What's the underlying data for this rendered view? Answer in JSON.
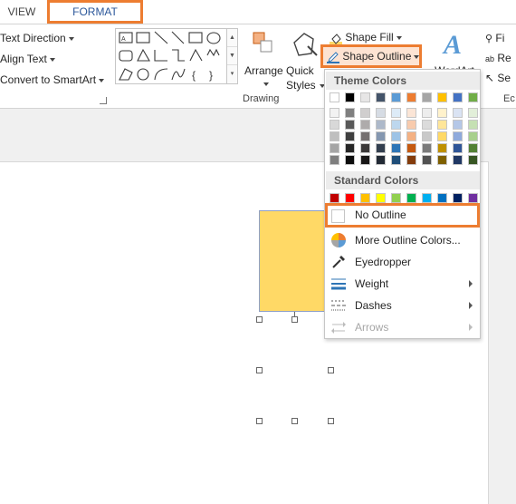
{
  "tabs": {
    "view": "VIEW",
    "format": "FORMAT"
  },
  "text_group": {
    "text_direction": "Text Direction",
    "align_text": "Align Text",
    "convert_smartart": "Convert to SmartArt"
  },
  "drawing": {
    "arrange": "Arrange",
    "quick": "Quick",
    "styles": "Styles",
    "group_label": "Drawing"
  },
  "shape_fill": "Shape Fill",
  "shape_outline": "Shape Outline",
  "wordart": "WordArt",
  "right_col": [
    "Fi",
    "Re",
    "Se"
  ],
  "right_label": "Ec",
  "menu": {
    "theme_header": "Theme Colors",
    "standard_header": "Standard Colors",
    "no_outline": "No Outline",
    "more_colors": "More Outline Colors...",
    "eyedropper": "Eyedropper",
    "weight": "Weight",
    "dashes": "Dashes",
    "arrows": "Arrows"
  },
  "theme_top_colors": [
    "#ffffff",
    "#000000",
    "#e7e6e6",
    "#44546a",
    "#5b9bd5",
    "#ed7d31",
    "#a5a5a5",
    "#ffc000",
    "#4472c4",
    "#70ad47"
  ],
  "theme_shades": [
    [
      "#f2f2f2",
      "#7f7f7f",
      "#d0cece",
      "#d6dce4",
      "#ddebf7",
      "#fbe5d6",
      "#ededed",
      "#fff2cc",
      "#dae3f3",
      "#e2efd9"
    ],
    [
      "#d8d8d8",
      "#595959",
      "#aeabab",
      "#adb9ca",
      "#bdd7ee",
      "#f8cbad",
      "#dbdbdb",
      "#ffe699",
      "#b4c7e7",
      "#c5e0b3"
    ],
    [
      "#bfbfbf",
      "#3f3f3f",
      "#757070",
      "#8497b0",
      "#9dc3e6",
      "#f4b183",
      "#c9c9c9",
      "#ffd966",
      "#8faadc",
      "#a8d08d"
    ],
    [
      "#a5a5a5",
      "#262626",
      "#3a3838",
      "#333f4f",
      "#2e75b6",
      "#c55a11",
      "#7b7b7b",
      "#bf9000",
      "#2f5597",
      "#538135"
    ],
    [
      "#7f7f7f",
      "#0d0d0d",
      "#171616",
      "#222a35",
      "#1f4e79",
      "#843c0c",
      "#525252",
      "#7f6000",
      "#203864",
      "#375623"
    ]
  ],
  "standard_colors": [
    "#c00000",
    "#ff0000",
    "#ffc000",
    "#ffff00",
    "#92d050",
    "#00b050",
    "#00b0f0",
    "#0070c0",
    "#002060",
    "#7030a0"
  ],
  "shape_fill_color": "#ffd966",
  "highlight_color": "#ED7D31"
}
